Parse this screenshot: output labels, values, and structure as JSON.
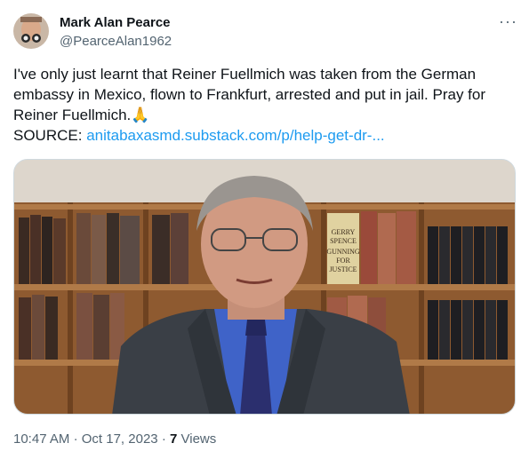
{
  "author": {
    "name": "Mark Alan Pearce",
    "handle": "@PearceAlan1962"
  },
  "more_icon": "more-horizontal-icon",
  "tweet": {
    "lines": [
      "I've only just learnt that Reiner Fuellmich was taken from the German",
      "embassy in Mexico, flown to Frankfurt, arrested and put in jail. Pray for",
      "Reiner Fuellmich."
    ],
    "emoji": "🙏",
    "source_label": "SOURCE:",
    "source_link": "anitabaxasmd.substack.com/p/help-get-dr-..."
  },
  "media": {
    "book_title": [
      "GERRY",
      "SPENCE",
      "GUNNING",
      "FOR",
      "JUSTICE"
    ]
  },
  "meta": {
    "time": "10:47 AM",
    "date": "Oct 17, 2023",
    "views_count": "7",
    "views_label": "Views"
  },
  "colors": {
    "link": "#1d9bf0",
    "secondary_text": "#536471",
    "shirt": "#3f63c8",
    "tie": "#2b2f6e",
    "jacket": "#3a3f46",
    "shelf_wood": "#a06a3c"
  }
}
